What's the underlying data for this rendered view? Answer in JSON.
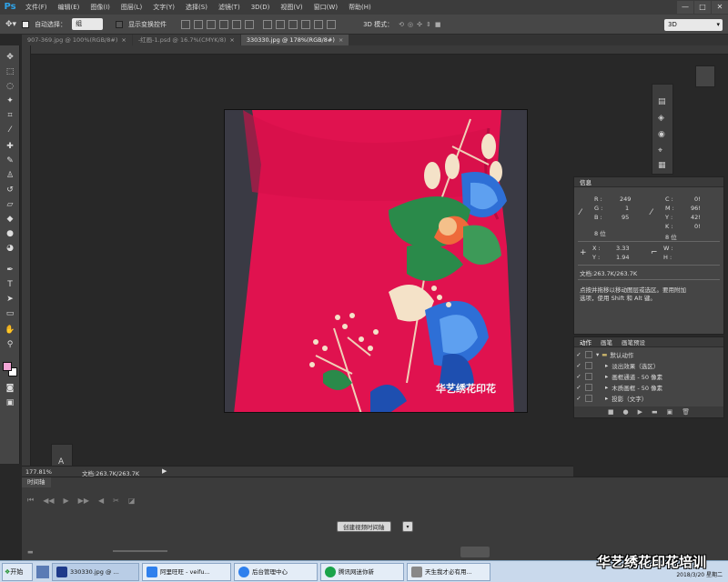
{
  "app": {
    "logo": "Ps"
  },
  "menu": [
    "文件(F)",
    "编辑(E)",
    "图像(I)",
    "图层(L)",
    "文字(Y)",
    "选择(S)",
    "滤镜(T)",
    "3D(D)",
    "视图(V)",
    "窗口(W)",
    "帮助(H)"
  ],
  "window_controls": [
    "—",
    "□",
    "✕"
  ],
  "options": {
    "auto_select_label": "自动选择：",
    "auto_select_value": "组",
    "show_transform_label": "显示变换控件",
    "mode3d_label": "3D 模式：",
    "workspace": "3D"
  },
  "tabs": [
    {
      "label": "907-369.jpg @ 100%(RGB/8#)",
      "active": false
    },
    {
      "label": "-红画-1.psd @ 16.7%(CMYK/8)",
      "active": false
    },
    {
      "label": "330330.jpg @ 178%(RGB/8#)",
      "active": true
    }
  ],
  "image": {
    "watermark": "华艺绣花印花"
  },
  "info_panel": {
    "title": "信息",
    "rgb": {
      "R_label": "R :",
      "R": "249",
      "G_label": "G :",
      "G": "1",
      "B_label": "B :",
      "B": "95",
      "bits": "8 位"
    },
    "cmyk": {
      "C_label": "C :",
      "C": "0!",
      "M_label": "M :",
      "M": "96!",
      "Y_label": "Y :",
      "Y": "42!",
      "K_label": "K :",
      "K": "0!",
      "bits": "8 位"
    },
    "xy": {
      "X_label": "X :",
      "X": "3.33",
      "Y_label": "Y :",
      "Y": "1.94"
    },
    "wh": {
      "W_label": "W :",
      "W": "",
      "H_label": "H :",
      "H": ""
    },
    "doc": "文档:263.7K/263.7K",
    "hint": [
      "点按并拖移以移动图层或选区。要用附加",
      "选项，使用 Shift 和 Alt 键。"
    ]
  },
  "actions_panel": {
    "tabs": [
      "动作",
      "画笔",
      "画笔预设"
    ],
    "rows": [
      {
        "label": "默认动作",
        "indent": 0,
        "folder": true
      },
      {
        "label": "淡出效果（选区）",
        "indent": 1,
        "folder": false
      },
      {
        "label": "画框通道 - 50 像素",
        "indent": 1,
        "folder": false
      },
      {
        "label": "木质画框 - 50 像素",
        "indent": 1,
        "folder": false
      },
      {
        "label": "投影（文字）",
        "indent": 1,
        "folder": false
      }
    ]
  },
  "status": {
    "zoom": "177.81%",
    "doc": "文档:263.7K/263.7K"
  },
  "timeline": {
    "title": "时间轴",
    "create_button": "创建视频时间轴"
  },
  "taskbar": {
    "start": "开始",
    "tasks": [
      {
        "label": "330330.jpg @ ...",
        "icon_color": "#1e3a8a",
        "active": true
      },
      {
        "label": "阿里旺旺 - veifu...",
        "icon_color": "#2f80ed",
        "active": false
      },
      {
        "label": "后台管理中心",
        "icon_color": "#2f80ed",
        "active": false
      },
      {
        "label": "腾讯网迷你新",
        "icon_color": "#1aa34a",
        "active": false
      },
      {
        "label": "天生我才必有用...",
        "icon_color": "#888888",
        "active": false
      }
    ],
    "overlay": "华艺绣花印花培训",
    "clock_date": "2018/3/20 星期二"
  },
  "colors": {
    "foreground": "#f3a6d6",
    "background": "#ffffff",
    "accent": "#2fa3e8"
  }
}
